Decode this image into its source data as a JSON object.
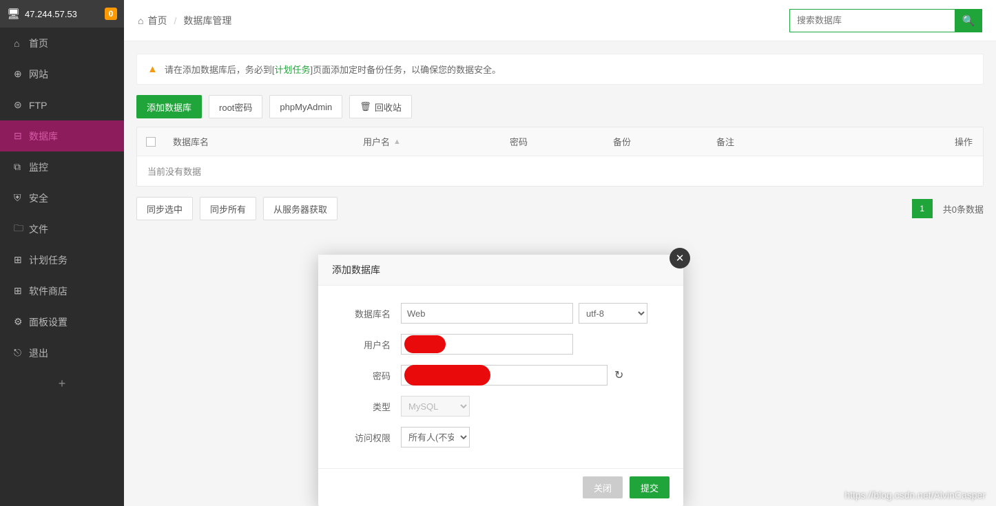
{
  "header": {
    "ip": "47.244.57.53",
    "notification_count": "0"
  },
  "sidebar": {
    "items": [
      {
        "icon": "⌂",
        "label": "首页"
      },
      {
        "icon": "⊕",
        "label": "网站"
      },
      {
        "icon": "⊜",
        "label": "FTP"
      },
      {
        "icon": "⊟",
        "label": "数据库"
      },
      {
        "icon": "⧉",
        "label": "监控"
      },
      {
        "icon": "⛨",
        "label": "安全"
      },
      {
        "icon": "🗀",
        "label": "文件"
      },
      {
        "icon": "⊞",
        "label": "计划任务"
      },
      {
        "icon": "⊞",
        "label": "软件商店"
      },
      {
        "icon": "⚙",
        "label": "面板设置"
      },
      {
        "icon": "⎋",
        "label": "退出"
      }
    ]
  },
  "crumb": {
    "home": "首页",
    "current": "数据库管理"
  },
  "search": {
    "placeholder": "搜索数据库"
  },
  "alert": {
    "prefix": "请在添加数据库后，务必到[",
    "link": "计划任务",
    "suffix": "]页面添加定时备份任务，以确保您的数据安全。"
  },
  "actions": {
    "add_db": "添加数据库",
    "root_pwd": "root密码",
    "phpmyadmin": "phpMyAdmin",
    "recycle": "回收站"
  },
  "table": {
    "headers": {
      "name": "数据库名",
      "user": "用户名",
      "pwd": "密码",
      "backup": "备份",
      "remark": "备注",
      "op": "操作"
    },
    "empty": "当前没有数据"
  },
  "footer_actions": {
    "sync_selected": "同步选中",
    "sync_all": "同步所有",
    "fetch_server": "从服务器获取"
  },
  "pagination": {
    "page": "1",
    "total": "共0条数据"
  },
  "modal": {
    "title": "添加数据库",
    "labels": {
      "db_name": "数据库名",
      "user": "用户名",
      "pwd": "密码",
      "type": "类型",
      "access": "访问权限"
    },
    "values": {
      "db_name": "Web",
      "encoding": "utf-8",
      "type": "MySQL",
      "access": "所有人(不安全"
    },
    "buttons": {
      "close": "关闭",
      "submit": "提交"
    }
  },
  "watermark": "https://blog.csdn.net/AlvinCasper"
}
